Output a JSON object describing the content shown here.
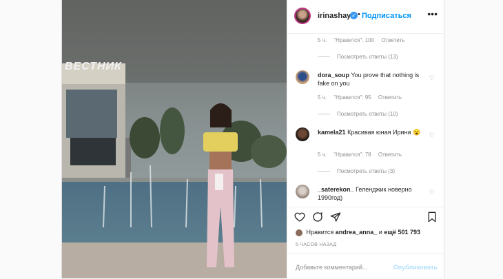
{
  "header": {
    "username": "irinashayk",
    "dot": "•",
    "follow": "Подписаться",
    "more": "•••"
  },
  "photo": {
    "sign_text": "ВЕСТНИК"
  },
  "comments": [
    {
      "meta": {
        "time": "5 ч.",
        "likes": "\"Нравится\": 100",
        "reply": "Ответить"
      },
      "replies": "Посмотреть ответы (13)"
    },
    {
      "user": "dora_soup",
      "text": "You prove that nothing is fake on you",
      "meta": {
        "time": "5 ч.",
        "likes": "\"Нравится\": 95",
        "reply": "Ответить"
      },
      "replies": "Посмотреть ответы (10)"
    },
    {
      "user": "kamela21",
      "text": "Красивая юная Ирина 😮",
      "meta": {
        "time": "5 ч.",
        "likes": "\"Нравится\": 78",
        "reply": "Ответить"
      },
      "replies": "Посмотреть ответы (3)"
    },
    {
      "user": "_saterekon_",
      "text": "Геленджик новерно 1990год)"
    }
  ],
  "likes": {
    "prefix": "Нравится",
    "user": "andrea_anna_",
    "mid": "и",
    "rest": "ещё 501 793"
  },
  "time_ago": "5 ЧАСОВ НАЗАД",
  "add_comment": {
    "placeholder": "Добавьте комментарий...",
    "publish": "Опубликовать"
  },
  "icons": {
    "like": "heart-icon",
    "comment": "comment-icon",
    "share": "share-icon",
    "save": "bookmark-icon",
    "verified": "verified-icon",
    "more": "more-icon"
  },
  "colors": {
    "accent": "#0095f6",
    "muted": "#8e8e8e",
    "text": "#262626"
  }
}
